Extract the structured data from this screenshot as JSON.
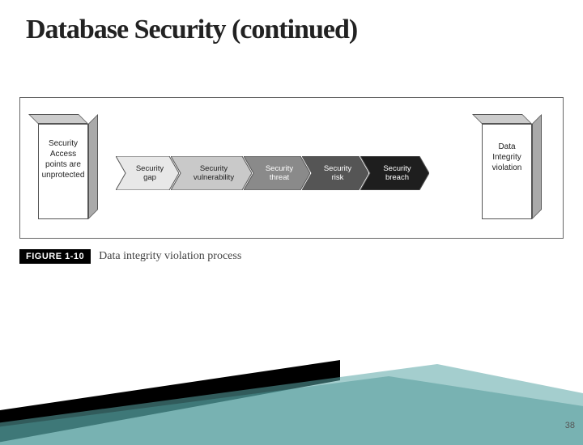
{
  "title": "Database Security (continued)",
  "figure": {
    "left_cube": "Security Access points are unprotected",
    "right_cube": "Data Integrity violation",
    "steps": [
      {
        "label": "Security\ngap",
        "fill": "#e8e8e8",
        "text_dark": true
      },
      {
        "label": "Security\nvulnerability",
        "fill": "#c9c9c9",
        "text_dark": true
      },
      {
        "label": "Security\nthreat",
        "fill": "#8a8a8a",
        "text_dark": false
      },
      {
        "label": "Security\nrisk",
        "fill": "#555555",
        "text_dark": false
      },
      {
        "label": "Security\nbreach",
        "fill": "#1e1e1e",
        "text_dark": false
      }
    ]
  },
  "caption": {
    "tag": "FIGURE 1-10",
    "text": "Data integrity violation process"
  },
  "page_number": "38"
}
